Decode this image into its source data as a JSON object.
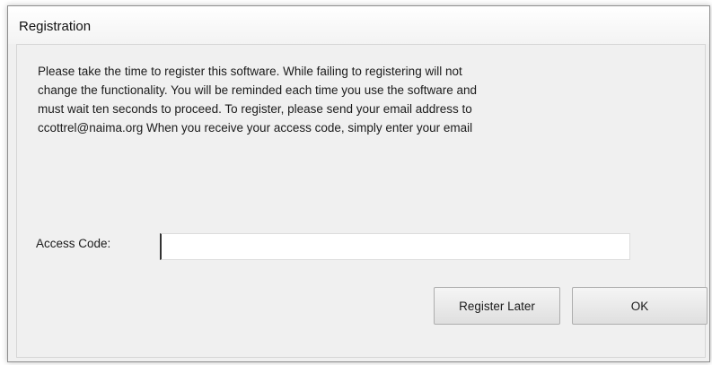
{
  "window": {
    "title": "Registration"
  },
  "message": {
    "lines": [
      "Please take the time to register this software.  While failing to registering will not",
      "change the functionality.  You will be reminded each time you use the software and",
      "must wait ten seconds to proceed.  To register, please send your email address to",
      "ccottrel@naima.org  When you receive your access code, simply enter your email"
    ]
  },
  "access_code": {
    "label": "Access Code:",
    "value": "",
    "placeholder": ""
  },
  "buttons": {
    "register_later": "Register Later",
    "ok": "OK"
  }
}
